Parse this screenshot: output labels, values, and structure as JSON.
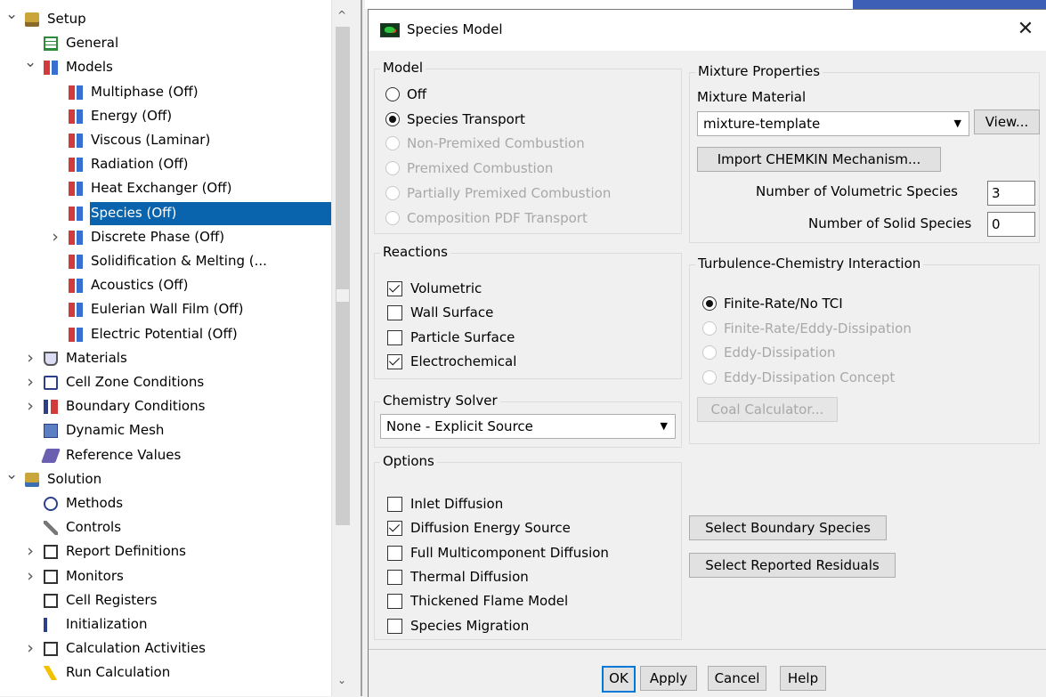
{
  "tree": {
    "items": [
      {
        "arrow": "down",
        "depth": 0,
        "icon": "setup-folder-icon",
        "label": "Setup"
      },
      {
        "arrow": "",
        "depth": 1,
        "icon": "general-list-icon",
        "label": "General"
      },
      {
        "arrow": "down",
        "depth": 1,
        "icon": "models-grid-icon",
        "label": "Models"
      },
      {
        "arrow": "",
        "depth": 2,
        "icon": "model-grid-icon",
        "label": "Multiphase (Off)"
      },
      {
        "arrow": "",
        "depth": 2,
        "icon": "model-grid-icon",
        "label": "Energy (Off)"
      },
      {
        "arrow": "",
        "depth": 2,
        "icon": "model-grid-icon",
        "label": "Viscous (Laminar)"
      },
      {
        "arrow": "",
        "depth": 2,
        "icon": "model-grid-icon",
        "label": "Radiation (Off)"
      },
      {
        "arrow": "",
        "depth": 2,
        "icon": "model-grid-icon",
        "label": "Heat Exchanger (Off)"
      },
      {
        "arrow": "",
        "depth": 2,
        "icon": "model-grid-icon",
        "label": "Species (Off)",
        "selected": true
      },
      {
        "arrow": "right",
        "depth": 2,
        "icon": "model-grid-icon",
        "label": "Discrete Phase (Off)"
      },
      {
        "arrow": "",
        "depth": 2,
        "icon": "model-grid-icon",
        "label": "Solidification & Melting (..."
      },
      {
        "arrow": "",
        "depth": 2,
        "icon": "model-grid-icon",
        "label": "Acoustics (Off)"
      },
      {
        "arrow": "",
        "depth": 2,
        "icon": "model-grid-icon",
        "label": "Eulerian Wall Film (Off)"
      },
      {
        "arrow": "",
        "depth": 2,
        "icon": "model-grid-icon",
        "label": "Electric Potential (Off)"
      },
      {
        "arrow": "right",
        "depth": 1,
        "icon": "materials-flask-icon",
        "label": "Materials"
      },
      {
        "arrow": "right",
        "depth": 1,
        "icon": "cell-zone-icon",
        "label": "Cell Zone Conditions"
      },
      {
        "arrow": "right",
        "depth": 1,
        "icon": "boundary-conditions-icon",
        "label": "Boundary Conditions"
      },
      {
        "arrow": "",
        "depth": 1,
        "icon": "dynamic-mesh-icon",
        "label": "Dynamic Mesh"
      },
      {
        "arrow": "",
        "depth": 1,
        "icon": "reference-values-icon",
        "label": "Reference Values"
      },
      {
        "arrow": "down",
        "depth": 0,
        "icon": "solution-folder-icon",
        "label": "Solution"
      },
      {
        "arrow": "",
        "depth": 1,
        "icon": "methods-icon",
        "label": "Methods"
      },
      {
        "arrow": "",
        "depth": 1,
        "icon": "controls-icon",
        "label": "Controls"
      },
      {
        "arrow": "right",
        "depth": 1,
        "icon": "report-definitions-icon",
        "label": "Report Definitions"
      },
      {
        "arrow": "right",
        "depth": 1,
        "icon": "monitors-icon",
        "label": "Monitors"
      },
      {
        "arrow": "",
        "depth": 1,
        "icon": "cell-registers-icon",
        "label": "Cell Registers"
      },
      {
        "arrow": "",
        "depth": 1,
        "icon": "initialization-icon",
        "label": "Initialization"
      },
      {
        "arrow": "right",
        "depth": 1,
        "icon": "calculation-activities-icon",
        "label": "Calculation Activities"
      },
      {
        "arrow": "",
        "depth": 1,
        "icon": "run-calculation-icon",
        "label": "Run Calculation"
      }
    ]
  },
  "dialog": {
    "title": "Species Model",
    "model": {
      "title": "Model",
      "options": [
        {
          "label": "Off",
          "checked": false,
          "disabled": false
        },
        {
          "label": "Species Transport",
          "checked": true,
          "disabled": false
        },
        {
          "label": "Non-Premixed Combustion",
          "checked": false,
          "disabled": true
        },
        {
          "label": "Premixed Combustion",
          "checked": false,
          "disabled": true
        },
        {
          "label": "Partially Premixed Combustion",
          "checked": false,
          "disabled": true
        },
        {
          "label": "Composition PDF Transport",
          "checked": false,
          "disabled": true
        }
      ]
    },
    "reactions": {
      "title": "Reactions",
      "options": [
        {
          "label": "Volumetric",
          "checked": true
        },
        {
          "label": "Wall Surface",
          "checked": false
        },
        {
          "label": "Particle Surface",
          "checked": false
        },
        {
          "label": "Electrochemical",
          "checked": true
        }
      ]
    },
    "chemistry_solver": {
      "title": "Chemistry Solver",
      "value": "None - Explicit Source"
    },
    "options": {
      "title": "Options",
      "items": [
        {
          "label": "Inlet Diffusion",
          "checked": false
        },
        {
          "label": "Diffusion Energy Source",
          "checked": true
        },
        {
          "label": "Full Multicomponent Diffusion",
          "checked": false
        },
        {
          "label": "Thermal Diffusion",
          "checked": false
        },
        {
          "label": "Thickened Flame Model",
          "checked": false
        },
        {
          "label": "Species Migration",
          "checked": false
        }
      ]
    },
    "mixture": {
      "title": "Mixture Properties",
      "material_label": "Mixture Material",
      "material_value": "mixture-template",
      "view_label": "View...",
      "import_label": "Import CHEMKIN Mechanism...",
      "vol_species_label": "Number of Volumetric Species",
      "vol_species_value": "3",
      "solid_species_label": "Number of Solid Species",
      "solid_species_value": "0"
    },
    "tci": {
      "title": "Turbulence-Chemistry Interaction",
      "options": [
        {
          "label": "Finite-Rate/No TCI",
          "checked": true,
          "disabled": false
        },
        {
          "label": "Finite-Rate/Eddy-Dissipation",
          "checked": false,
          "disabled": true
        },
        {
          "label": "Eddy-Dissipation",
          "checked": false,
          "disabled": true
        },
        {
          "label": "Eddy-Dissipation Concept",
          "checked": false,
          "disabled": true
        }
      ],
      "coal_label": "Coal Calculator..."
    },
    "select_boundary_label": "Select Boundary Species",
    "select_residuals_label": "Select Reported Residuals",
    "buttons": {
      "ok": "OK",
      "apply": "Apply",
      "cancel": "Cancel",
      "help": "Help"
    }
  }
}
